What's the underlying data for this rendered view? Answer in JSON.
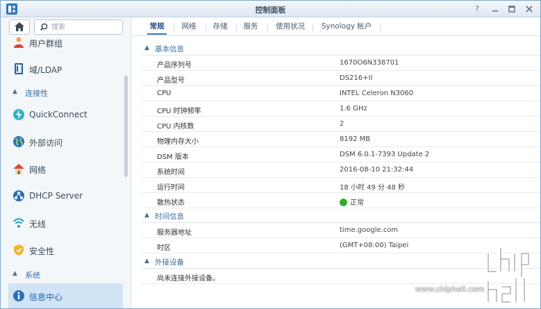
{
  "window": {
    "title": "控制面板"
  },
  "search": {
    "placeholder": "搜索"
  },
  "sidebar": {
    "items": [
      {
        "label": "用户群组",
        "icon": "user-group-icon"
      },
      {
        "label": "域/LDAP",
        "icon": "domain-ldap-icon"
      },
      {
        "header": "连接性"
      },
      {
        "label": "QuickConnect",
        "icon": "quickconnect-icon"
      },
      {
        "label": "外部访问",
        "icon": "external-access-icon"
      },
      {
        "label": "网络",
        "icon": "network-icon"
      },
      {
        "label": "DHCP Server",
        "icon": "dhcp-server-icon"
      },
      {
        "label": "无线",
        "icon": "wireless-icon"
      },
      {
        "label": "安全性",
        "icon": "security-shield-icon"
      },
      {
        "header": "系统"
      },
      {
        "label": "信息中心",
        "icon": "info-center-icon",
        "active": true
      }
    ]
  },
  "tabs": [
    "常规",
    "网络",
    "存储",
    "服务",
    "使用状况",
    "Synology 帐户"
  ],
  "sections": {
    "basic": {
      "title": "基本信息",
      "rows": [
        {
          "key": "产品序列号",
          "value": "1670O6N338701"
        },
        {
          "key": "产品型号",
          "value": "DS216+II"
        },
        {
          "key": "CPU",
          "value": "INTEL Celeron N3060"
        },
        {
          "key": "CPU 时钟频率",
          "value": "1.6 GHz"
        },
        {
          "key": "CPU 内核数",
          "value": "2"
        },
        {
          "key": "物理内存大小",
          "value": "8192 MB"
        },
        {
          "key": "DSM 版本",
          "value": "DSM 6.0.1-7393 Update 2"
        },
        {
          "key": "系统时间",
          "value": "2016-08-10 21:32:44"
        },
        {
          "key": "运行时间",
          "value": "18 小时 49 分 48 秒"
        },
        {
          "key": "散热状态",
          "value": "正常",
          "status_color": "#2fae2f"
        }
      ]
    },
    "time": {
      "title": "时间信息",
      "rows": [
        {
          "key": "服务器地址",
          "value": "time.google.com"
        },
        {
          "key": "时区",
          "value": "(GMT+08:00) Taipei"
        }
      ]
    },
    "external": {
      "title": "外接设备",
      "message": "尚未连接外接设备。"
    }
  },
  "watermark": {
    "url": "www.chiphell.com"
  },
  "colors": {
    "accent": "#2e73c0",
    "active_bg": "#d0e4f5",
    "section_title": "#3c6ea0",
    "status_ok": "#2fae2f"
  }
}
